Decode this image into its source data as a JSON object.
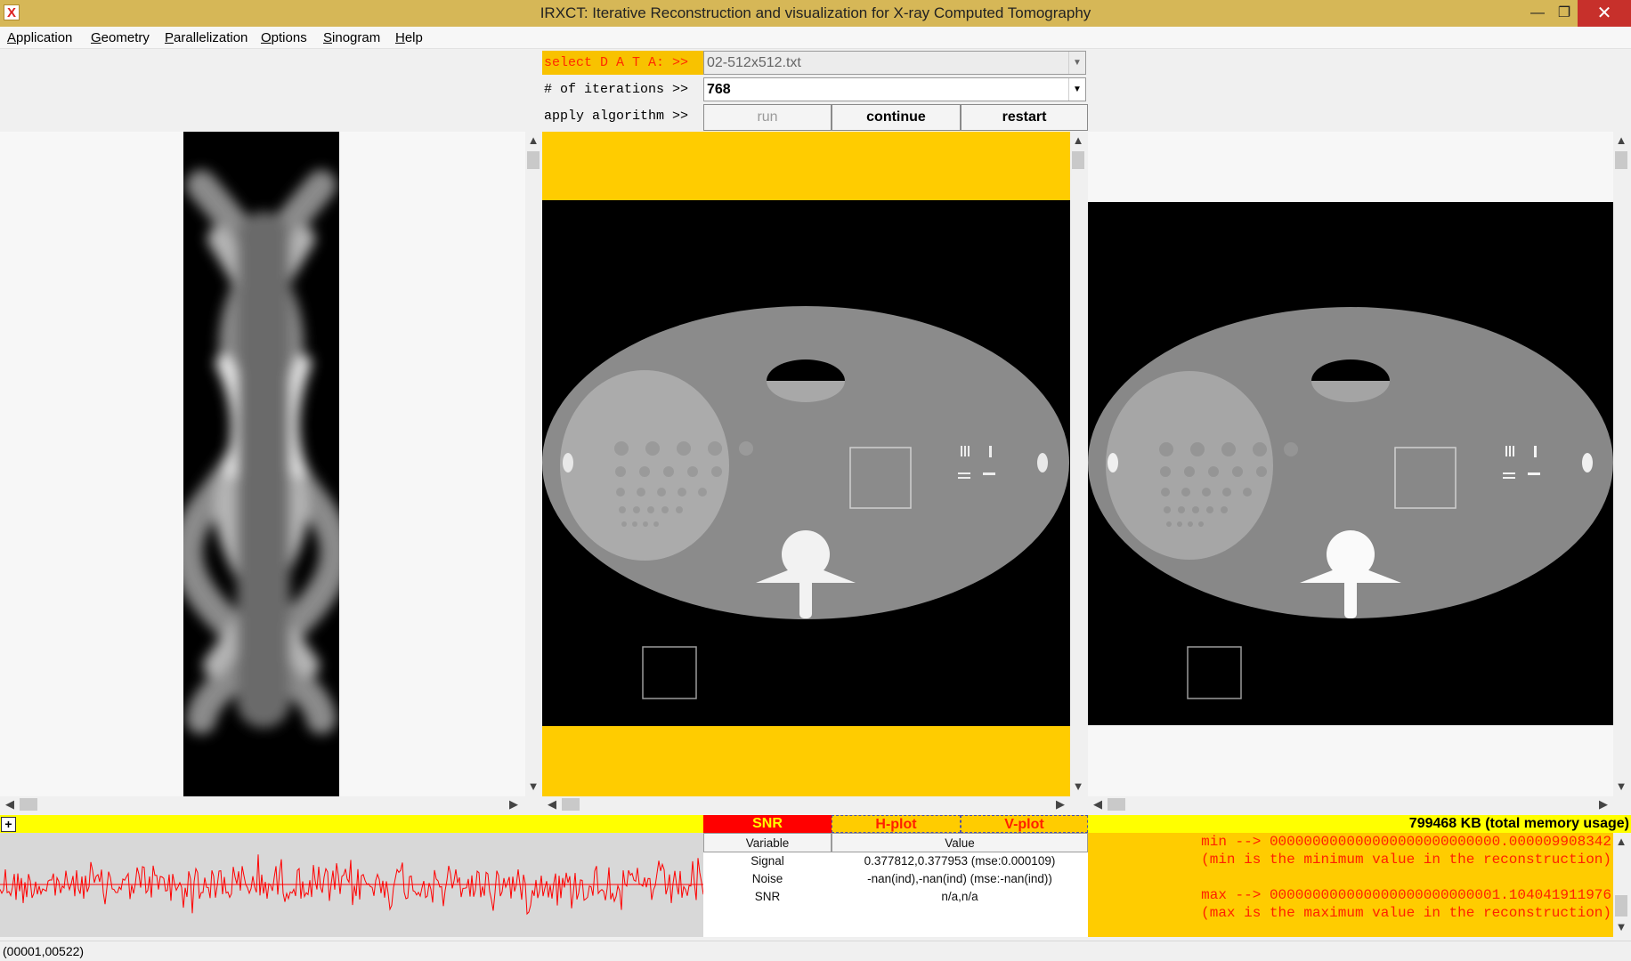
{
  "window": {
    "title": "IRXCT: Iterative Reconstruction and visualization for X-ray Computed Tomography",
    "app_icon": "X",
    "minimize": "—",
    "maximize": "❐",
    "close": "✕"
  },
  "menu": [
    "Application",
    "Geometry",
    "Parallelization",
    "Options",
    "Sinogram",
    "Help"
  ],
  "controls": {
    "data_label": "select D A T A: >>",
    "data_value": "02-512x512.txt",
    "iterations_label": "# of iterations >>",
    "iterations_value": "768",
    "algorithm_label": "apply algorithm >>",
    "buttons": {
      "run": "run",
      "continue": "continue",
      "restart": "restart"
    }
  },
  "bottom": {
    "tabs": {
      "snr": "SNR",
      "hplot": "H-plot",
      "vplot": "V-plot"
    },
    "memory": "799468 KB (total memory usage)",
    "table": {
      "headers": [
        "Variable",
        "Value"
      ],
      "rows": [
        [
          "Signal",
          "0.377812,0.377953 (mse:0.000109)"
        ],
        [
          "Noise",
          "-nan(ind),-nan(ind) (mse:-nan(ind))"
        ],
        [
          "SNR",
          "n/a,n/a"
        ]
      ]
    },
    "recon_info": {
      "min_line": "min --> 000000000000000000000000000.000009908342",
      "min_note": "(min is the minimum value in the reconstruction)",
      "max_line": "max --> 000000000000000000000000001.104041911976",
      "max_note": "(max is the maximum value in the reconstruction)"
    }
  },
  "status": "(00001,00522)",
  "colors": {
    "titlebar": "#d6b757",
    "accent_yellow": "#ffcc00",
    "status_yellow": "#ffff00",
    "snr_tab": "#ff0000",
    "signal_trace": "#ff0000"
  },
  "icons": {
    "scroll_up": "▲",
    "scroll_down": "▼",
    "scroll_left": "◀",
    "scroll_right": "▶",
    "expand": "+"
  }
}
